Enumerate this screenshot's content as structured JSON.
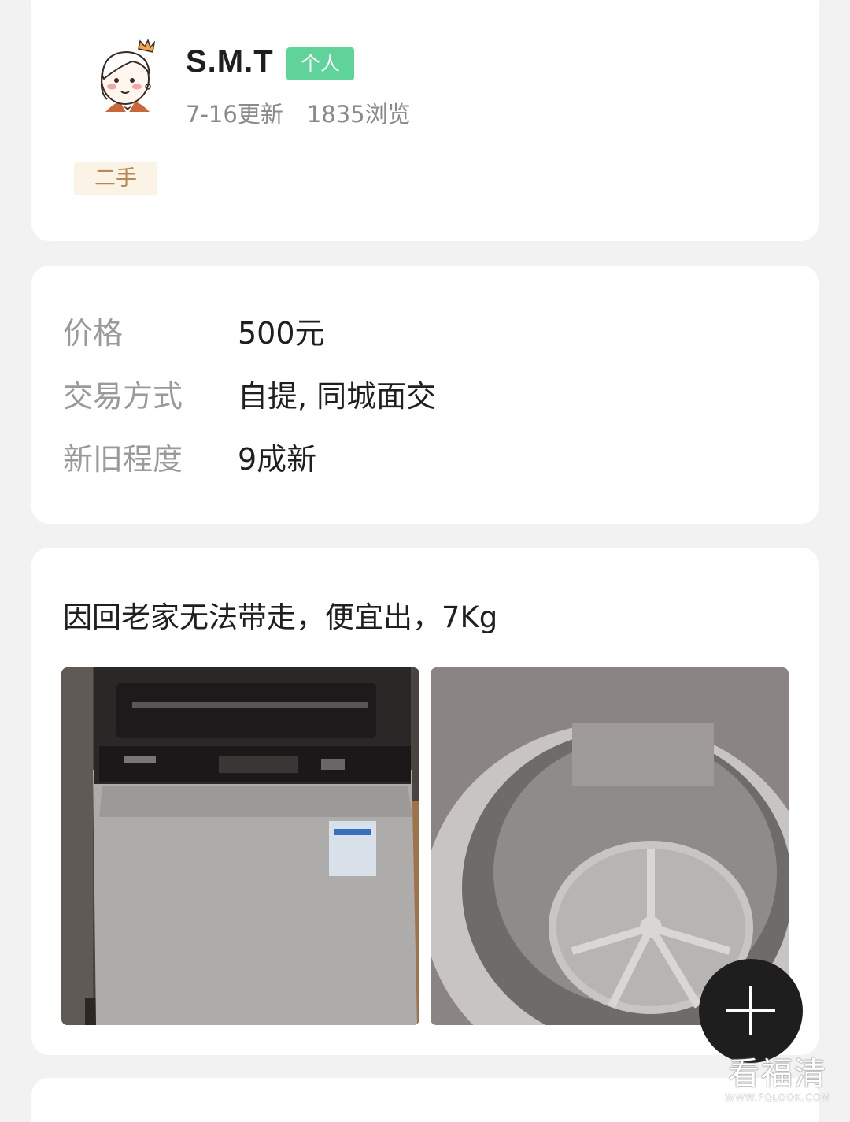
{
  "seller": {
    "name": "S.M.T",
    "badge": "个人",
    "updated": "7-16更新",
    "views": "1835浏览",
    "tag": "二手"
  },
  "details": [
    {
      "label": "价格",
      "value": "500元"
    },
    {
      "label": "交易方式",
      "value": "自提, 同城面交"
    },
    {
      "label": "新旧程度",
      "value": "9成新"
    }
  ],
  "description": "因回老家无法带走，便宜出，7Kg",
  "icons": {
    "avatar": "cartoon-girl-crown-avatar",
    "fab": "plus-icon"
  },
  "watermark": {
    "brand": "看福清",
    "url": "WWW.FQLOOK.COM"
  },
  "colors": {
    "badge_green": "#5fd39a",
    "tag_bg": "#fbf3e6",
    "tag_text": "#b98a4f",
    "fab": "#1e1e1e"
  }
}
